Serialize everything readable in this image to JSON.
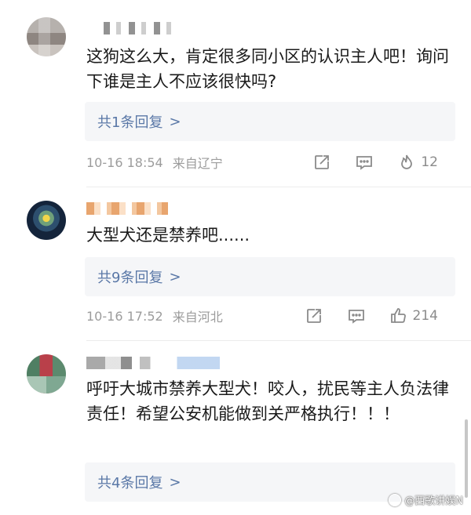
{
  "comments": [
    {
      "text": "这狗这么大，肯定很多同小区的认识主人吧！询问下谁是主人不应该很快吗?",
      "replies_label": "共1条回复",
      "chevron": ">",
      "time": "10-16 18:54",
      "location": "来自辽宁",
      "like_icon": "fire-icon",
      "likes": "12"
    },
    {
      "text": "大型犬还是禁养吧......",
      "replies_label": "共9条回复",
      "chevron": ">",
      "time": "10-16 17:52",
      "location": "来自河北",
      "like_icon": "thumbs-up-icon",
      "likes": "214"
    },
    {
      "text": "呼吁大城市禁养大型犬！咬人，扰民等主人负法律责任！希望公安机能做到关严格执行！！！",
      "replies_label": "共4条回复",
      "chevron": ">"
    }
  ],
  "watermark": "@西歌讲娱N",
  "colors": {
    "reply_link": "#5a78a7",
    "meta_gray": "#9c9c9c",
    "reply_bg": "#f5f6f8"
  }
}
